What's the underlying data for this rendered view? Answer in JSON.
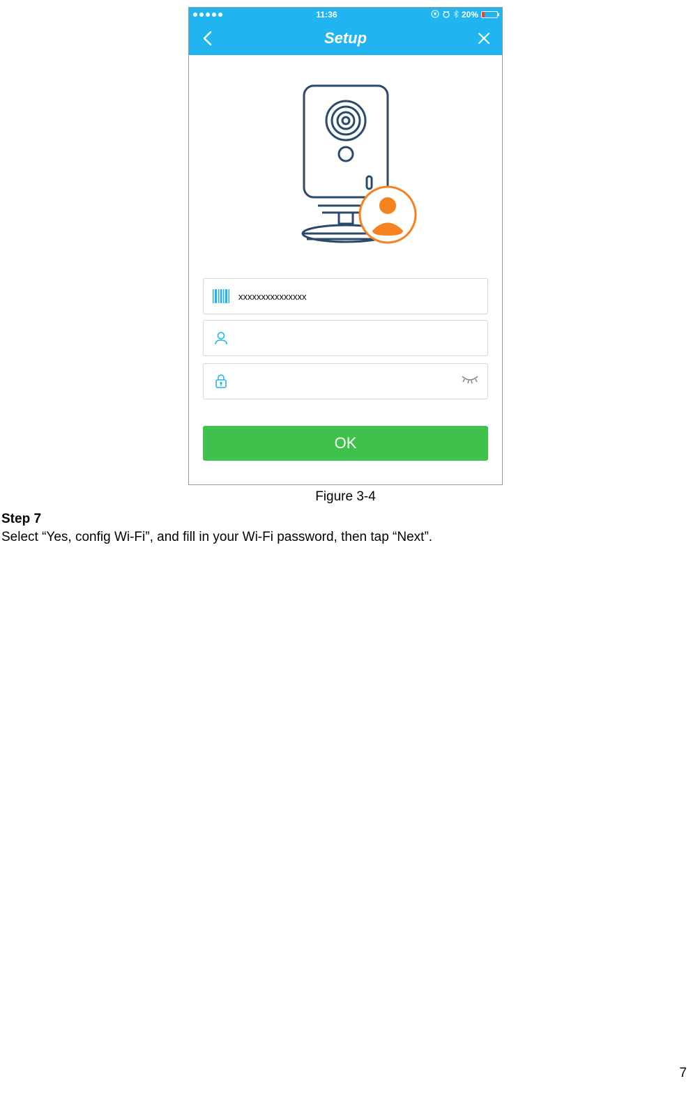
{
  "status": {
    "time": "11:36",
    "battery_pct": "20%"
  },
  "nav": {
    "title": "Setup"
  },
  "fields": {
    "barcode_value": "xxxxxxxxxxxxxxx",
    "username_value": "",
    "password_value": ""
  },
  "button": {
    "ok_label": "OK"
  },
  "caption": "Figure 3-4",
  "step": {
    "heading": "Step 7",
    "text": "Select “Yes, config Wi-Fi”, and fill in your Wi-Fi password, then tap “Next”."
  },
  "page_number": "7"
}
